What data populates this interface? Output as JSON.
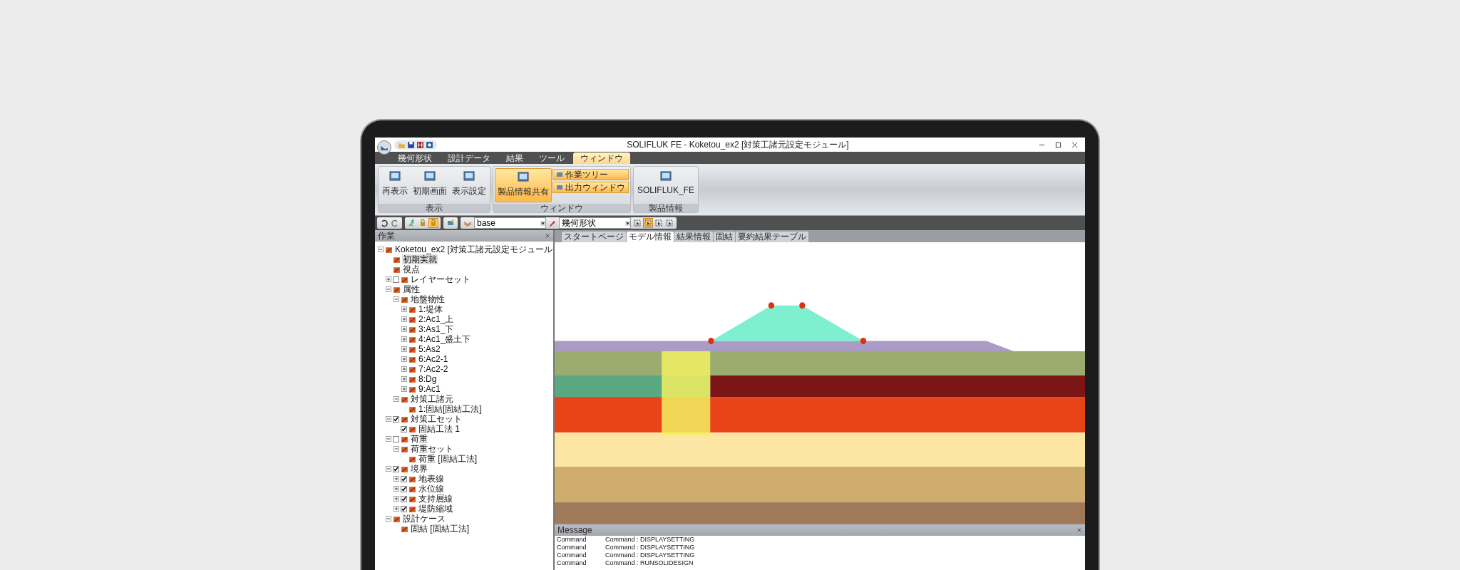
{
  "window": {
    "title": "SOLIFLUK FE - Koketou_ex2 [対策工諸元設定モジュール]"
  },
  "ribbon": {
    "tabs": [
      {
        "label": "幾何形状",
        "selected": false
      },
      {
        "label": "設計データ",
        "selected": false
      },
      {
        "label": "結果",
        "selected": false
      },
      {
        "label": "ツール",
        "selected": false
      },
      {
        "label": "ウィンドウ",
        "selected": true
      }
    ],
    "groups": [
      {
        "label": "表示",
        "buttons": [
          {
            "label": "再表示",
            "kind": "large",
            "selected": false
          },
          {
            "label": "初期画面",
            "kind": "large",
            "selected": false
          },
          {
            "label": "表示設定",
            "kind": "large",
            "selected": false
          }
        ]
      },
      {
        "label": "ウィンドウ",
        "buttons": [
          {
            "label": "製品情報共有",
            "kind": "large",
            "selected": true
          },
          {
            "label": "作業ツリー",
            "kind": "small",
            "selected": true
          },
          {
            "label": "出力ウィンドウ",
            "kind": "small",
            "selected": true
          }
        ]
      },
      {
        "label": "製品情報",
        "buttons": [
          {
            "label": "SOLIFLUK_FE",
            "kind": "large",
            "selected": false
          }
        ]
      }
    ]
  },
  "toolbar": {
    "layer": "base",
    "view": "幾何形状",
    "tools": [
      {
        "selected": false
      },
      {
        "selected": true
      },
      {
        "selected": false
      },
      {
        "selected": false
      }
    ]
  },
  "work_panel": {
    "title": "作業"
  },
  "tree": {
    "label": "Koketou_ex2 [対策工諸元設定モジュール",
    "expanded": true,
    "selected": false,
    "children": [
      {
        "label": "初期実就",
        "selected": true
      },
      {
        "label": "視点",
        "selected": false
      },
      {
        "label": "レイヤーセット",
        "expanded": false,
        "checked": false,
        "selected": false
      },
      {
        "label": "属性",
        "expanded": true,
        "selected": false,
        "children": [
          {
            "label": "地盤物性",
            "expanded": true,
            "selected": false,
            "children": [
              {
                "label": "1:堤体",
                "expanded": false,
                "selected": false
              },
              {
                "label": "2:Ac1_上",
                "expanded": false,
                "selected": false
              },
              {
                "label": "3:As1_下",
                "expanded": false,
                "selected": false
              },
              {
                "label": "4:Ac1_盛土下",
                "expanded": false,
                "selected": false
              },
              {
                "label": "5:As2",
                "expanded": false,
                "selected": false
              },
              {
                "label": "6:Ac2-1",
                "expanded": false,
                "selected": false
              },
              {
                "label": "7:Ac2-2",
                "expanded": false,
                "selected": false
              },
              {
                "label": "8:Dg",
                "expanded": false,
                "selected": false
              },
              {
                "label": "9:Ac1",
                "expanded": false,
                "selected": false
              }
            ]
          },
          {
            "label": "対策工諸元",
            "expanded": true,
            "selected": false,
            "children": [
              {
                "label": "1:固結[固結工法]",
                "selected": false
              }
            ]
          }
        ]
      },
      {
        "label": "対策工セット",
        "expanded": true,
        "checked": true,
        "selected": false,
        "children": [
          {
            "label": "固結工法 1",
            "checked": true,
            "selected": false
          }
        ]
      },
      {
        "label": "荷重",
        "expanded": true,
        "checked": false,
        "selected": false,
        "children": [
          {
            "label": "荷重セット",
            "expanded": true,
            "selected": false,
            "children": [
              {
                "label": "荷重 [固結工法]",
                "selected": false
              }
            ]
          }
        ]
      },
      {
        "label": "境界",
        "expanded": true,
        "checked": true,
        "selected": false,
        "children": [
          {
            "label": "地表線",
            "expanded": false,
            "checked": true,
            "selected": false
          },
          {
            "label": "水位線",
            "expanded": false,
            "checked": true,
            "selected": false
          },
          {
            "label": "支持層線",
            "expanded": false,
            "checked": true,
            "selected": false
          },
          {
            "label": "堤防縮域",
            "expanded": false,
            "checked": true,
            "selected": false
          }
        ]
      },
      {
        "label": "設計ケース",
        "expanded": true,
        "selected": false,
        "children": [
          {
            "label": "固結 [固結工法]",
            "selected": false
          }
        ]
      }
    ]
  },
  "document_tabs": [
    {
      "label": "スタートページ",
      "selected": false
    },
    {
      "label": "モデル情報",
      "selected": true
    },
    {
      "label": "結果情報",
      "selected": false
    },
    {
      "label": "固結",
      "selected": false
    },
    {
      "label": "要約結果テーブル",
      "selected": false
    }
  ],
  "message_panel": {
    "title": "Message",
    "rows": [
      {
        "type": "Command",
        "text": "Command : DISPLAYSETTING"
      },
      {
        "type": "Command",
        "text": "Command : DISPLAYSETTING"
      },
      {
        "type": "Command",
        "text": "Command : DISPLAYSETTING"
      },
      {
        "type": "Command",
        "text": "Command : RUNSOLIDESIGN"
      }
    ]
  }
}
